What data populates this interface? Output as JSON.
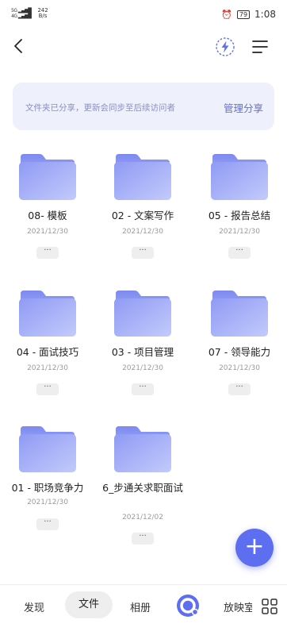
{
  "status_bar": {
    "signal1": "5G",
    "signal2": "4G",
    "speed_value": "242",
    "speed_unit": "B/s",
    "battery": "79",
    "time": "1:08"
  },
  "toolbar": {
    "back_icon": "chevron-left-icon",
    "speed_icon": "lightning-icon",
    "menu_icon": "menu-icon"
  },
  "banner": {
    "text": "文件夹已分享，更新会同步至后续访问者",
    "action": "管理分享"
  },
  "folders": [
    {
      "name": "08- 模板",
      "date": "2021/12/30"
    },
    {
      "name": "02 - 文案写作",
      "date": "2021/12/30"
    },
    {
      "name": "05 - 报告总结",
      "date": "2021/12/30"
    },
    {
      "name": "04 - 面试技巧",
      "date": "2021/12/30"
    },
    {
      "name": "03 - 项目管理",
      "date": "2021/12/30"
    },
    {
      "name": "07 - 领导能力",
      "date": "2021/12/30"
    },
    {
      "name": "01 - 职场竞争力",
      "date": "2021/12/30"
    },
    {
      "name": "6_步通关求职面试",
      "date": "2021/12/02"
    }
  ],
  "more_label": "···",
  "fab": {
    "label": "+"
  },
  "bottom_nav": {
    "discover": "发现",
    "files": "文件",
    "album": "相册",
    "cast": "放映室"
  },
  "colors": {
    "accent": "#5d6ff0",
    "banner_bg": "#eef0fc",
    "folder_light": "#b8c2fb",
    "folder_dark": "#8e9af3"
  }
}
